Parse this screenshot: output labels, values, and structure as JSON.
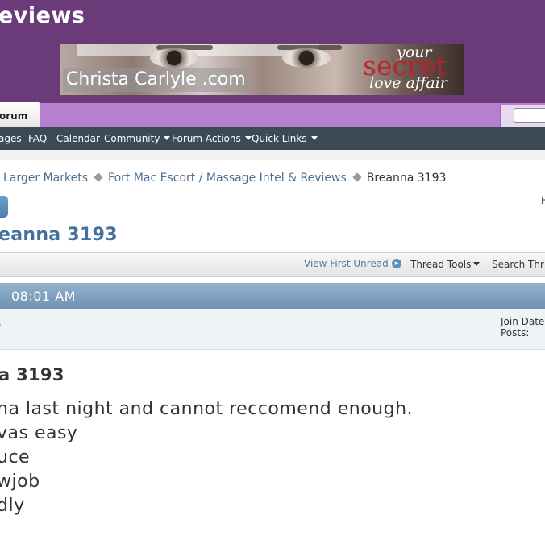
{
  "header": {
    "site_title": "eviews",
    "banner": {
      "text": "Christa Carlyle .com",
      "script_line1": "your",
      "script_line2": "secret",
      "script_line3": "love affair"
    }
  },
  "tabs": {
    "forum": "orum"
  },
  "navbar": {
    "items": [
      {
        "label": "ages",
        "dropdown": false
      },
      {
        "label": "FAQ",
        "dropdown": false
      },
      {
        "label": "Calendar",
        "dropdown": false
      },
      {
        "label": "Community",
        "dropdown": true
      },
      {
        "label": "Forum Actions",
        "dropdown": true
      },
      {
        "label": "Quick Links",
        "dropdown": true
      }
    ]
  },
  "breadcrumb": {
    "items": [
      "Larger Markets",
      "Fort Mac Escort / Massage Intel & Reviews"
    ],
    "current": "Breanna 3193"
  },
  "right_clip": "F",
  "thread": {
    "title": "eanna 3193"
  },
  "tools": {
    "view_first_unread": "View First Unread",
    "thread_tools": "Thread Tools",
    "search_thread": "Search Thr"
  },
  "post": {
    "time": "08:01 AM",
    "join_date_label": "Join Date",
    "posts_label": "Posts:",
    "left_marker": "·",
    "title": "a 3193",
    "body_lines": [
      "na last night and cannot reccomend enough.",
      "vas easy",
      "uce",
      "wjob",
      "dly"
    ]
  },
  "colors": {
    "header_bg": "#6b3a78",
    "tabbar_bg": "#b77fd0",
    "navbar_bg": "#3c4a56",
    "link": "#4b6f94",
    "post_header": "#7f9fbd"
  }
}
